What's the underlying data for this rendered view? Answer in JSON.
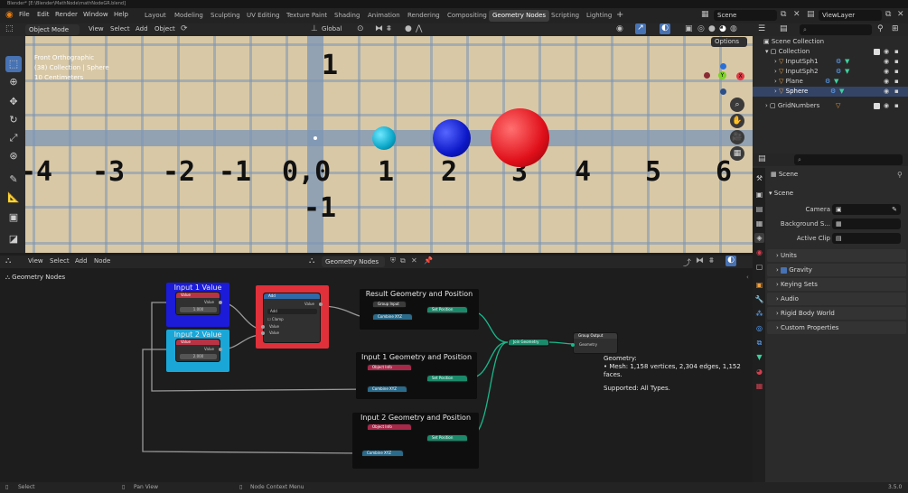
{
  "titlebar": {
    "text": "Blender* [E:\\Blender\\MathNode\\mathNodeGR.blend]"
  },
  "menu": [
    "File",
    "Edit",
    "Render",
    "Window",
    "Help"
  ],
  "workspaces": [
    "Layout",
    "Modeling",
    "Sculpting",
    "UV Editing",
    "Texture Paint",
    "Shading",
    "Animation",
    "Rendering",
    "Compositing",
    "Geometry Nodes",
    "Scripting",
    "Lighting"
  ],
  "active_workspace": "Geometry Nodes",
  "scene": {
    "name": "Scene",
    "view_layer": "ViewLayer"
  },
  "viewport_header": {
    "mode": "Object Mode",
    "menus": [
      "View",
      "Select",
      "Add",
      "Object"
    ],
    "transform": "Global",
    "options": "Options"
  },
  "viewport_overlay": {
    "line1": "Front Orthographic",
    "line2": "(38) Collection | Sphere",
    "line3": "10 Centimeters"
  },
  "grid_numbers": {
    "x": [
      "-4",
      "-3",
      "-2",
      "-1",
      "0,0",
      "1",
      "2",
      "3",
      "4",
      "5",
      "6"
    ],
    "y_top": "1",
    "y_bottom": "-1"
  },
  "outliner": {
    "root": "Scene Collection",
    "collection": "Collection",
    "items": [
      "InputSph1",
      "InputSph2",
      "Plane",
      "Sphere"
    ],
    "gridnumbers": "GridNumbers"
  },
  "properties": {
    "scene_name": "Scene",
    "panel_scene": "Scene",
    "camera_label": "Camera",
    "background_label": "Background S...",
    "active_clip_label": "Active Clip",
    "panels": [
      "Units",
      "Gravity",
      "Keying Sets",
      "Audio",
      "Rigid Body World",
      "Custom Properties"
    ]
  },
  "node_editor": {
    "header_menus": [
      "View",
      "Select",
      "Add",
      "Node"
    ],
    "tree_name": "Geometry Nodes",
    "breadcrumb": "Geometry Nodes",
    "frames": {
      "input1": "Input 1 Value",
      "input2": "Input 2 Value",
      "result": "Result Geometry and Position",
      "input1geo": "Input 1 Geometry and Position",
      "input2geo": "Input 2 Geometry and Position"
    },
    "nodes": {
      "value1": {
        "title": "Value",
        "out": "Value",
        "val": "1.000"
      },
      "value2": {
        "title": "Value",
        "out": "Value",
        "val": "2.000"
      },
      "add": {
        "title": "Add",
        "out": "Value",
        "op": "Add",
        "clamp": "Clamp",
        "in1": "Value",
        "in2": "Value"
      },
      "group_input": "Group Input",
      "combine_xyz": "Combine XYZ",
      "set_position": "Set Position",
      "object_info": "Object Info",
      "join_geometry": "Join Geometry",
      "group_output": "Group Output",
      "geometry": "Geometry"
    },
    "tooltip": {
      "title": "Geometry:",
      "line1": "• Mesh: 1,158 vertices, 2,304 edges, 1,152 faces.",
      "line2": "Supported: All Types."
    }
  },
  "status": {
    "select": "Select",
    "pan": "Pan View",
    "ctx": "Node Context Menu",
    "version": "3.5.0"
  },
  "colors": {
    "accent": "#4772b3",
    "frame_blue": "#1b1bd8",
    "frame_cyan": "#1aa7d8",
    "frame_red": "#e0303a",
    "wire_green": "#18b98a"
  }
}
